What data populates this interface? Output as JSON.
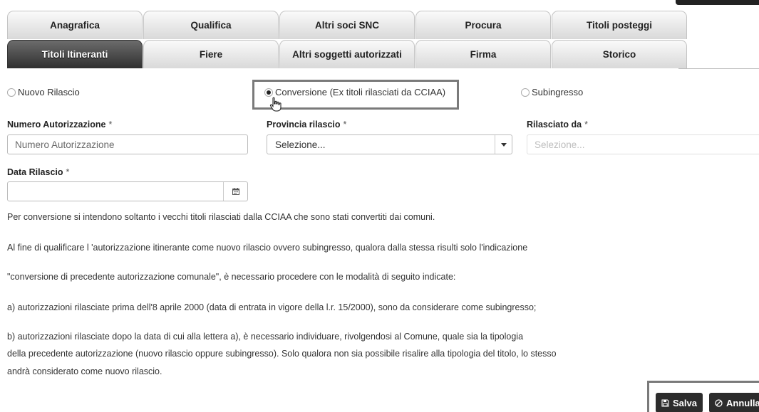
{
  "tabs": {
    "row1": [
      {
        "label": "Anagrafica"
      },
      {
        "label": "Qualifica"
      },
      {
        "label": "Altri soci SNC"
      },
      {
        "label": "Procura"
      },
      {
        "label": "Titoli posteggi"
      }
    ],
    "row2": [
      {
        "label": "Titoli Itineranti",
        "active": true
      },
      {
        "label": "Fiere"
      },
      {
        "label": "Altri soggetti autorizzati"
      },
      {
        "label": "Firma"
      },
      {
        "label": "Storico"
      }
    ]
  },
  "issue_type": {
    "options": [
      "Nuovo Rilascio",
      "Conversione (Ex titoli rilasciati da CCIAA)",
      "Subingresso"
    ],
    "selected": "Conversione (Ex titoli rilasciati da CCIAA)"
  },
  "form": {
    "required_marker": "*",
    "numero_autorizzazione": {
      "label": "Numero Autorizzazione",
      "placeholder": "Numero Autorizzazione",
      "value": ""
    },
    "provincia_rilascio": {
      "label": "Provincia rilascio",
      "value": "Selezione..."
    },
    "rilasciato_da": {
      "label": "Rilasciato da",
      "placeholder": "Selezione...",
      "value": ""
    },
    "data_rilascio": {
      "label": "Data Rilascio",
      "value": ""
    }
  },
  "info_text": [
    "Per conversione si intendono soltanto i vecchi titoli rilasciati dalla CCIAA che sono stati convertiti dai comuni.",
    "Al fine di qualificare l 'autorizzazione itinerante come nuovo rilascio ovvero subingresso, qualora dalla stessa risulti solo l'indicazione",
    "\"conversione di precedente autorizzazione comunale\", è necessario procedere con le modalità di seguito indicate:",
    "a) autorizzazioni rilasciate prima dell'8 aprile 2000 (data di entrata in vigore della l.r. 15/2000), sono da considerare come subingresso;",
    "b) autorizzazioni rilasciate dopo la data di cui alla lettera a), è necessario individuare, rivolgendosi al Comune, quale sia la tipologia",
    "della precedente autorizzazione (nuovo rilascio oppure subingresso). Solo qualora non sia possibile risalire alla tipologia del titolo, lo stesso",
    "andrà considerato come nuovo rilascio."
  ],
  "actions": {
    "save_label": "Salva",
    "cancel_label": "Annulla"
  },
  "icons": {
    "save": "floppy-disk-icon",
    "cancel": "ban-icon",
    "date": "calendar-icon",
    "dropdown": "caret-down-icon"
  }
}
